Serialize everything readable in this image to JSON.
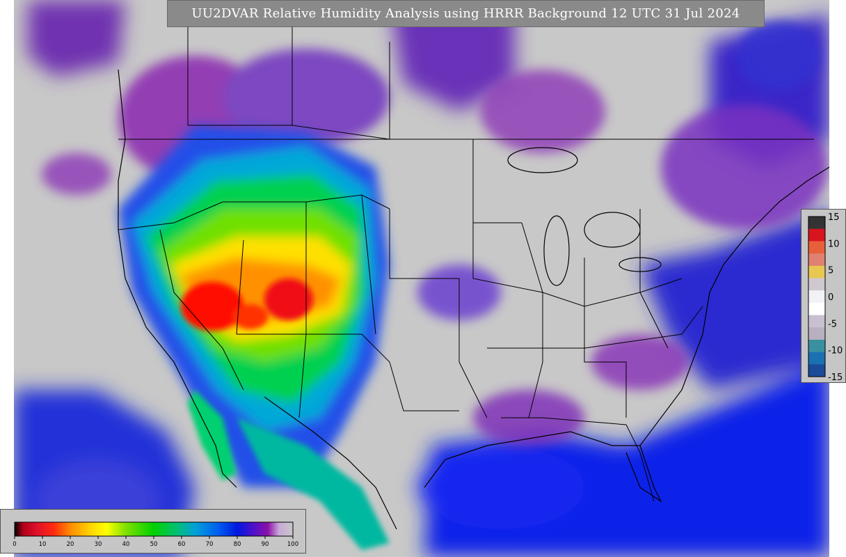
{
  "title": "UU2DVAR Relative Humidity Analysis using HRRR Background 12 UTC 31 Jul 2024",
  "humidity_legend": {
    "ticks": [
      "0",
      "10",
      "20",
      "30",
      "40",
      "50",
      "60",
      "70",
      "80",
      "90",
      "100"
    ],
    "stops": [
      {
        "value": 0,
        "color": "#000000"
      },
      {
        "value": 3,
        "color": "#b00018"
      },
      {
        "value": 8,
        "color": "#e0102a"
      },
      {
        "value": 14,
        "color": "#ff2a10"
      },
      {
        "value": 20,
        "color": "#ff8c00"
      },
      {
        "value": 27,
        "color": "#ffd200"
      },
      {
        "value": 33,
        "color": "#ffff00"
      },
      {
        "value": 40,
        "color": "#7fe000"
      },
      {
        "value": 50,
        "color": "#00d000"
      },
      {
        "value": 58,
        "color": "#00c070"
      },
      {
        "value": 65,
        "color": "#00a0d8"
      },
      {
        "value": 73,
        "color": "#0060f0"
      },
      {
        "value": 80,
        "color": "#0018e0"
      },
      {
        "value": 86,
        "color": "#5010c8"
      },
      {
        "value": 91,
        "color": "#8a10a8"
      },
      {
        "value": 95,
        "color": "#c8a8d8"
      },
      {
        "value": 100,
        "color": "#c8c8c8"
      }
    ]
  },
  "increment_legend": {
    "ticks": [
      "15",
      "10",
      "5",
      "0",
      "-5",
      "-10",
      "-15"
    ],
    "colors": [
      "#333333",
      "#d8141e",
      "#e8603a",
      "#e08070",
      "#e8c850",
      "#d0c8d0",
      "#f2f2f6",
      "#ffffff",
      "#c8c0d0",
      "#b8b0c0",
      "#3a90a0",
      "#1a70b0",
      "#1a4a98"
    ]
  },
  "map": {
    "background_color": "#c8c8c8",
    "ocean_color": "#1010e0",
    "dry_core_color": "#ff1000",
    "border_color": "#000000"
  }
}
